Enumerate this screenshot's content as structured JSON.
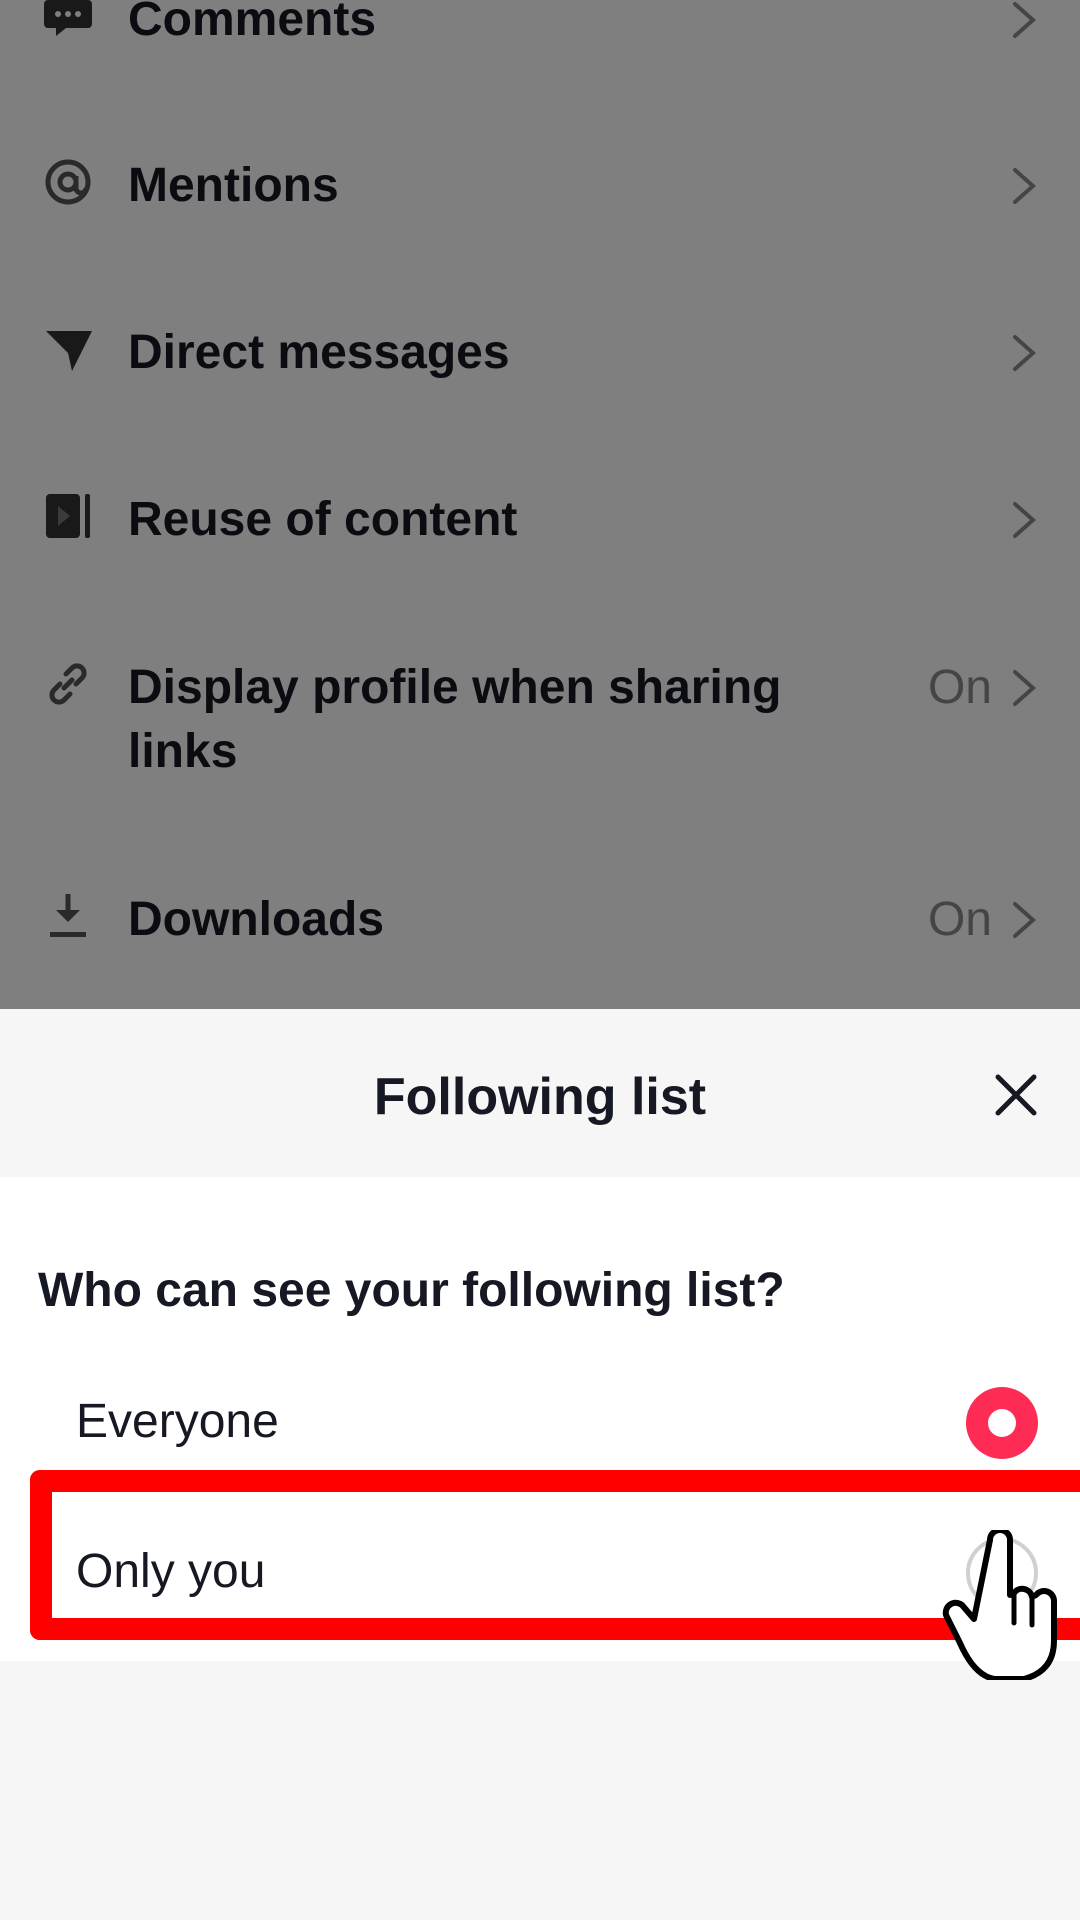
{
  "settings_list": {
    "items": [
      {
        "label": "Comments",
        "value": "",
        "icon": "comment-icon"
      },
      {
        "label": "Mentions",
        "value": "",
        "icon": "at-icon"
      },
      {
        "label": "Direct messages",
        "value": "",
        "icon": "send-icon"
      },
      {
        "label": "Reuse of content",
        "value": "",
        "icon": "video-reuse-icon"
      },
      {
        "label": "Display profile when sharing links",
        "value": "On",
        "icon": "link-icon"
      },
      {
        "label": "Downloads",
        "value": "On",
        "icon": "download-icon"
      }
    ]
  },
  "sheet": {
    "title": "Following list",
    "question": "Who can see your following list?",
    "options": [
      {
        "label": "Everyone",
        "selected": true
      },
      {
        "label": "Only you",
        "selected": false
      }
    ]
  },
  "colors": {
    "accent": "#fe2c55",
    "highlight": "#ff0000"
  }
}
